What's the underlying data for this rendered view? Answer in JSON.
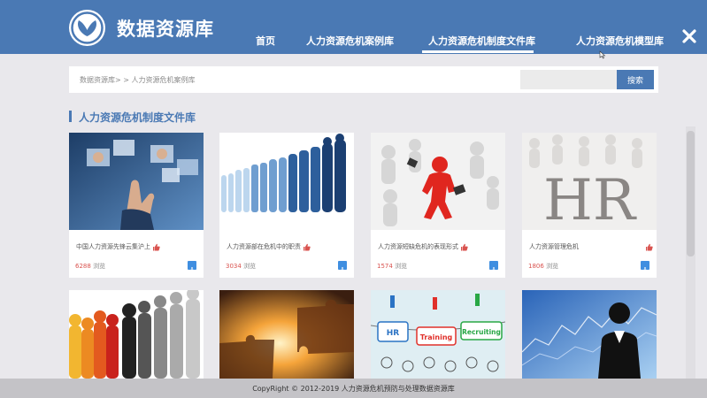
{
  "header": {
    "brand": "数据资源库",
    "nav": [
      {
        "label": "首页",
        "active": false
      },
      {
        "label": "人力资源危机案例库",
        "active": false
      },
      {
        "label": "人力资源危机制度文件库",
        "active": true
      },
      {
        "label": "人力资源危机模型库",
        "active": false
      }
    ],
    "close_icon": "close-icon"
  },
  "search": {
    "breadcrumb": "数据资源库> > 人力资源危机案例库",
    "placeholder": "",
    "button_label": "搜索"
  },
  "section": {
    "title": "人力资源危机制度文件库"
  },
  "cards": [
    {
      "title": "中国人力资源先锋云集沪上",
      "views": "6288",
      "views_unit": "浏览"
    },
    {
      "title": "人力资源部在危机中的职责",
      "views": "3034",
      "views_unit": "浏览"
    },
    {
      "title": "人力资源短缺危机的表现形式",
      "views": "1574",
      "views_unit": "浏览"
    },
    {
      "title": "人力资源管理危机",
      "views": "1806",
      "views_unit": "浏览"
    }
  ],
  "card_images": {
    "card4_text": "HR",
    "card7_tags": [
      "HR",
      "Training",
      "Recruiting"
    ]
  },
  "footer": {
    "text": "CopyRight © 2012-2019   人力资源危机预防与处理数据资源库"
  },
  "colors": {
    "header_bg": "#4a79b4",
    "accent": "#4a79b4",
    "views_number": "#d9534f",
    "thumb_up": "#d9534f",
    "open_button": "#3f8ee0",
    "page_bg": "#e9e8ec"
  }
}
